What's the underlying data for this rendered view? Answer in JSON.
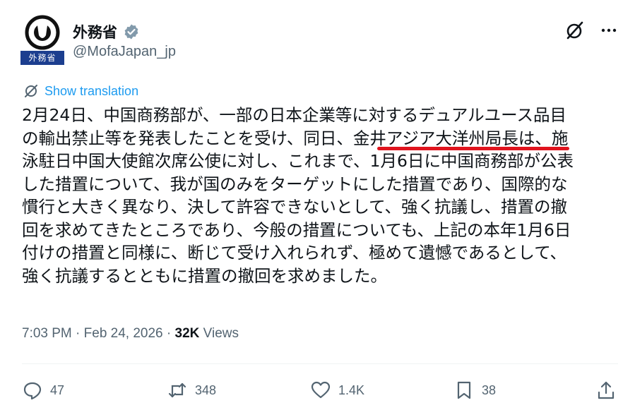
{
  "account": {
    "display_name": "外務省",
    "handle": "@MofaJapan_jp",
    "avatar_label": "外務省"
  },
  "post": {
    "show_translation": "Show translation",
    "lines": [
      "2月24日、中国商務部が、一部の日本企業等に対するデュアルユース品目",
      "の輸出禁止等を発表したことを受け、同日、金井アジア大洋州局長は、施",
      "泳駐日中国大使館次席公使に対し、これまで、1月6日に中国商務部が公表",
      "した措置について、我が国のみをターゲットにした措置であり、国際的な",
      "慣行と大きく異なり、決して許容できないとして、強く抗議し、措置の撤",
      "回を求めてきたところであり、今般の措置についても、上記の本年1月6日",
      "付けの措置と同様に、断じて受け入れられず、極めて遺憾であるとして、",
      "強く抗議するとともに措置の撤回を求めました。"
    ]
  },
  "meta": {
    "timestamp": "7:03 PM · Feb 24, 2026 · ",
    "views_count": "32K",
    "views_label": " Views"
  },
  "actions": {
    "replies": "47",
    "reposts": "348",
    "likes": "1.4K",
    "bookmarks": "38"
  },
  "colors": {
    "accent": "#1d9bf0",
    "secondary_text": "#536471",
    "primary_text": "#0f1419",
    "underline": "#e0141e",
    "avatar_banner": "#1c3e8f"
  }
}
